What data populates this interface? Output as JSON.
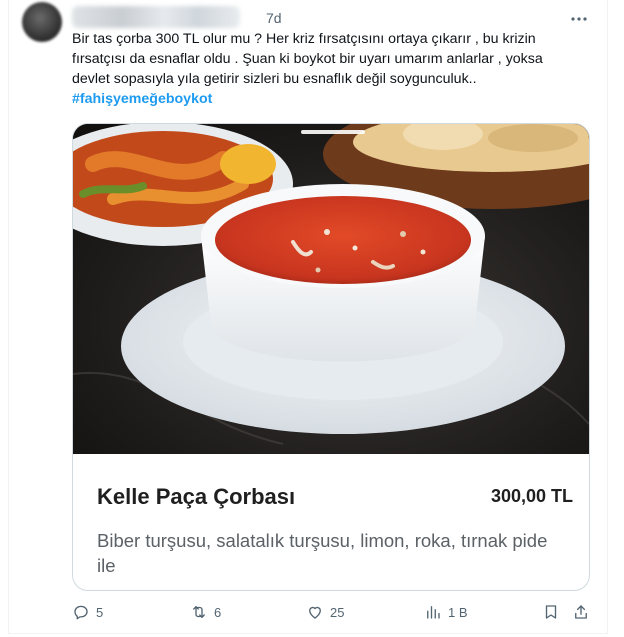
{
  "tweet": {
    "time": "7d",
    "lines": [
      "Bir tas çorba 300 TL olur mu ? Her kriz fırsatçısını ortaya çıkarır , bu krizin",
      "fırsatçısı da esnaflar oldu . Şuan ki boykot bir uyarı umarım anlarlar , yoksa",
      "devlet sopasıyla yıla getirir sizleri bu esnaflık değil soygunculuk.."
    ],
    "hashtag": "#fahişyemeğeboykot"
  },
  "card": {
    "title": "Kelle Paça Çorbası",
    "price": "300,00 TL",
    "description": "Biber turşusu, salatalık turşusu, limon, roka, tırnak pide ile"
  },
  "actions": {
    "replies": "5",
    "retweets": "6",
    "likes": "25",
    "views": "1 B"
  },
  "icons": {
    "reply": "reply-icon",
    "retweet": "retweet-icon",
    "like": "heart-icon",
    "views": "views-icon",
    "bookmark": "bookmark-icon",
    "share": "share-icon",
    "more": "more-icon"
  },
  "colors": {
    "link": "#1d9bf0",
    "secondary_text": "#536471",
    "soup": "#c8351f"
  }
}
